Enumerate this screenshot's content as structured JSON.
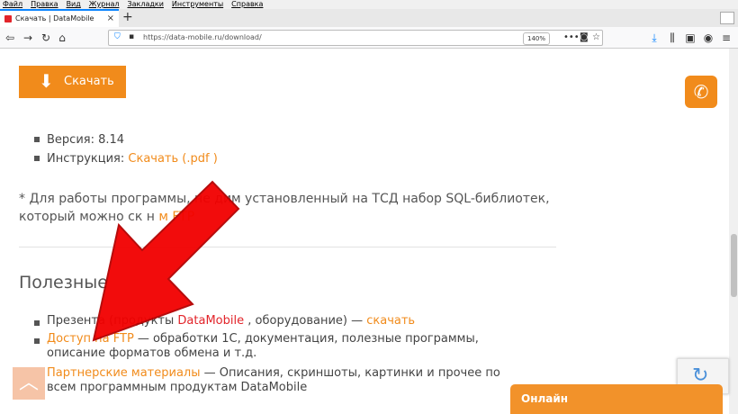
{
  "menu": [
    "Файл",
    "Правка",
    "Вид",
    "Журнал",
    "Закладки",
    "Инструменты",
    "Справка"
  ],
  "tab": {
    "title": "Скачать | DataMobile",
    "close": "×"
  },
  "newtab": "+",
  "url": "https://data-mobile.ru/download/",
  "zoom": "140%",
  "toolbar_icons": [
    "back-icon",
    "forward-icon",
    "reload-icon",
    "home-icon",
    "shield-icon",
    "lock-icon",
    "more-icon",
    "pocket-icon",
    "bookmark-star-icon",
    "download-icon",
    "library-icon",
    "sidebar-icon",
    "account-icon",
    "menu-icon"
  ],
  "download_button": {
    "label": "Скачать"
  },
  "info": {
    "version_label": "Версия: 8.14",
    "instr_label": "Инструкция:",
    "instr_link": "Скачать (.pdf )"
  },
  "note": {
    "part1": "* Для работы программы, не",
    "part2": "дим установленный на ТСД набор SQL-библиотек,",
    "part3": "который можно ск",
    "part4": "н",
    "link": "м FTP"
  },
  "section_title": "Полезные",
  "useful": {
    "pres_prefix": "Презента",
    "pres_mid": "(продукты",
    "pres_brand": "DataMobile",
    "pres_tail": ", оборудование) —",
    "pres_link": "скачать",
    "ftp_link": "Доступ на FTP",
    "ftp_text": " — обработки 1С, документация, полезные программы, описание форматов обмена и т.д.",
    "partners_link": "Партнерские материалы",
    "partners_text": " — Описания, скриншоты, картинки и прочее по всем программным продуктам DataMobile"
  },
  "online_label": "Онлайн",
  "colors": {
    "accent": "#f18b1b",
    "brand_red": "#e2242a",
    "annotation_arrow": "#f20000"
  }
}
